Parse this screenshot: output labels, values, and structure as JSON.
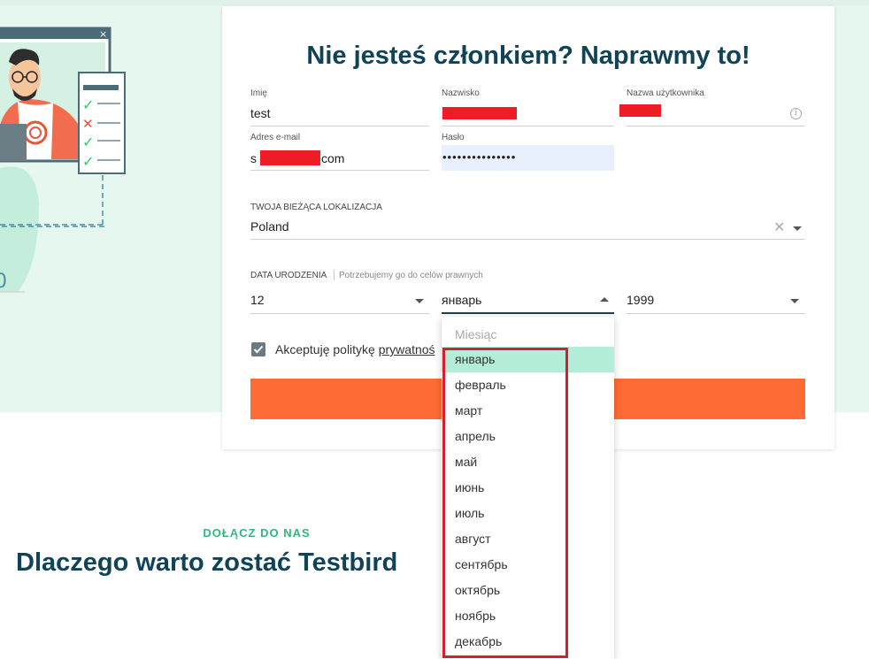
{
  "form": {
    "title": "Nie jesteś członkiem? Naprawmy to!",
    "first_name": {
      "label": "Imię",
      "value": "test"
    },
    "last_name": {
      "label": "Nazwisko"
    },
    "username": {
      "label": "Nazwa użytkownika"
    },
    "email": {
      "label": "Adres e-mail",
      "value_prefix": "s",
      "value_suffix": "com"
    },
    "password": {
      "label": "Hasło",
      "value": "•••••••••••••••"
    },
    "location": {
      "label": "TWOJA BIEŻĄCA LOKALIZACJA",
      "value": "Poland"
    },
    "birthdate": {
      "label": "DATA URODZENIA",
      "hint": "Potrzebujemy go do celów prawnych",
      "day": "12",
      "month": "январь",
      "year": "1999"
    },
    "consent": {
      "text": "Akceptuję politykę ",
      "link": "prywatnoś",
      "checked": true
    }
  },
  "month_dropdown": {
    "placeholder": "Miesiąc",
    "selected_index": 0,
    "options": [
      "январь",
      "февраль",
      "март",
      "апрель",
      "май",
      "июнь",
      "июль",
      "август",
      "сентябрь",
      "октябрь",
      "ноябрь",
      "декабрь"
    ]
  },
  "join": {
    "tag": "DOŁĄCZ DO NAS",
    "title": "Dlaczego warto zostać Testbird"
  },
  "colors": {
    "brand_dark": "#0f4357",
    "accent_orange": "#ff6b35",
    "accent_green": "#2fb87e",
    "selected_option": "#b4edd8",
    "highlight_box": "#d22030"
  }
}
